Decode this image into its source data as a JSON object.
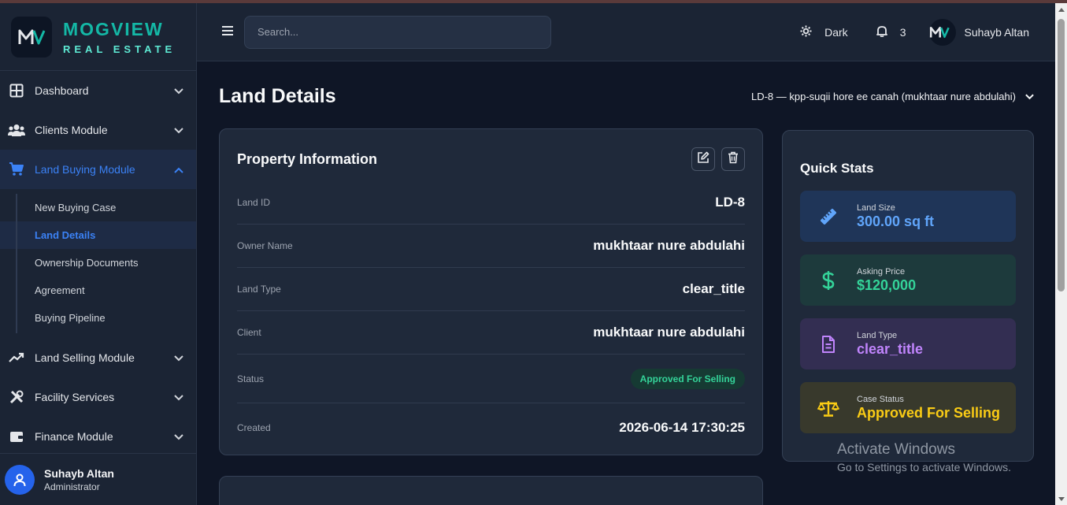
{
  "brand": {
    "name": "MOGVIEW",
    "sub": "REAL ESTATE"
  },
  "sidebar": {
    "items": [
      {
        "label": "Dashboard"
      },
      {
        "label": "Clients Module"
      },
      {
        "label": "Land Buying Module"
      },
      {
        "label": "Land Selling Module"
      },
      {
        "label": "Facility Services"
      },
      {
        "label": "Finance Module"
      }
    ],
    "sub_items": [
      {
        "label": "New Buying Case"
      },
      {
        "label": "Land Details"
      },
      {
        "label": "Ownership Documents"
      },
      {
        "label": "Agreement"
      },
      {
        "label": "Buying Pipeline"
      }
    ],
    "user": {
      "name": "Suhayb Altan",
      "role": "Administrator"
    }
  },
  "header": {
    "search_placeholder": "Search...",
    "theme_label": "Dark",
    "notification_count": "3",
    "user_name": "Suhayb Altan"
  },
  "main": {
    "title": "Land Details",
    "land_selector": "LD-8 — kpp-suqii hore ee canah (mukhtaar nure abdulahi)",
    "property": {
      "title": "Property Information",
      "rows": [
        {
          "label": "Land ID",
          "value": "LD-8"
        },
        {
          "label": "Owner Name",
          "value": "mukhtaar nure abdulahi"
        },
        {
          "label": "Land Type",
          "value": "clear_title"
        },
        {
          "label": "Client",
          "value": "mukhtaar nure abdulahi"
        },
        {
          "label": "Status",
          "value": "Approved For Selling"
        },
        {
          "label": "Created",
          "value": "2026-06-14 17:30:25"
        }
      ]
    },
    "quick_stats": {
      "title": "Quick Stats",
      "stats": [
        {
          "label": "Land Size",
          "value": "300.00 sq ft",
          "icon": "ruler-icon"
        },
        {
          "label": "Asking Price",
          "value": "$120,000",
          "icon": "dollar-icon"
        },
        {
          "label": "Land Type",
          "value": "clear_title",
          "icon": "document-icon"
        },
        {
          "label": "Case Status",
          "value": "Approved For Selling",
          "icon": "scale-icon"
        }
      ]
    }
  },
  "watermark": {
    "line1": "Activate Windows",
    "line2": "Go to Settings to activate Windows."
  },
  "colors": {
    "accent": "#3b82f6",
    "brand": "#14b8a6",
    "success": "#34d399",
    "warning": "#facc15",
    "purple": "#c084fc"
  }
}
